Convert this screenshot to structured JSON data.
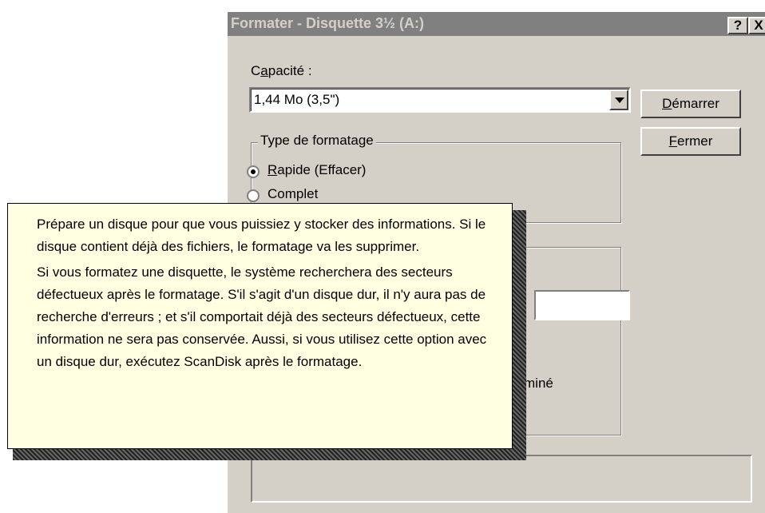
{
  "dialog": {
    "title": "Formater - Disquette 3½ (A:)",
    "help_button": "?",
    "close_button": "X",
    "capacity": {
      "label_pre": "C",
      "label_accel": "a",
      "label_post": "pacité :",
      "value": "1,44 Mo (3,5\")"
    },
    "buttons": {
      "start_accel": "D",
      "start_rest": "émarrer",
      "close_accel": "F",
      "close_rest": "ermer"
    },
    "format_type": {
      "legend": "Type de formatage",
      "quick_accel": "R",
      "quick_rest": "apide (Effacer)",
      "full_label": "Complet"
    },
    "partial_label": "miné"
  },
  "tooltip": {
    "paragraph1": "Prépare un disque pour que vous puissiez y stocker des informations. Si le disque contient déjà des fichiers, le formatage va les supprimer.",
    "paragraph2": "Si vous formatez une disquette, le système recherchera des secteurs défectueux après le formatage. S'il s'agit d'un disque dur, il n'y aura pas de recherche d'erreurs ; et s'il comportait déjà des secteurs défectueux, cette information ne sera pas conservée. Aussi, si vous utilisez cette option avec un disque dur, exécutez ScanDisk après le formatage."
  }
}
